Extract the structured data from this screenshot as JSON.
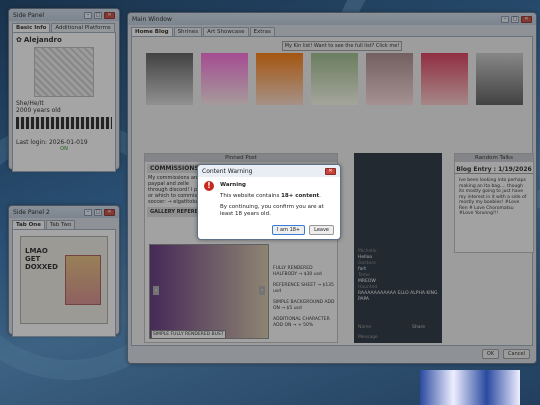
{
  "side_panel1": {
    "title": "Side Panel",
    "tabs": [
      "Basic Info",
      "Additional Platforms"
    ],
    "name": "Alejandro",
    "pronouns": "She/He/It",
    "age": "2000 years old",
    "last_login": "Last login: 2026-01-019",
    "status": "ON"
  },
  "side_panel2": {
    "title": "Side Panel 2",
    "tabs": [
      "Tab One",
      "Tab Two"
    ],
    "image_text": "LMAO GET DOXXED"
  },
  "main": {
    "title": "Main Window",
    "tabs": [
      "Home Blog",
      "Shrines",
      "Art Showcase",
      "Extras"
    ],
    "promo": "My Kin list! Want to see the full list? Click me!",
    "pinned_title": "Pinned Post",
    "commissions_h": "COMMISSIONS",
    "comm_text1": "My commissions are open! I take my commission payment through paypal and zelle",
    "comm_text2": "through discord! I prefer commissions being taken ahead of time",
    "comm_text3": "or which to commission ...",
    "comm_text4": "soccer: → elgatitobarco@...",
    "gallery_h": "GALLERY REFERENCE",
    "caption": "SIMPLE FULLY RENDERED BUST",
    "prices": [
      "FULLY RENDERED HALFBODY → $30 usd",
      "REFERENCE SHEET → $135 usd",
      "SIMPLE BACKGROUND ADD ON → $5 usd",
      "ADDITIONAL CHARACTER ADD ON → + 50%"
    ],
    "chat": [
      {
        "n": "Michelle",
        "m": "Helloo",
        "t": "5 minutes ago"
      },
      {
        "n": "Gesture",
        "m": "fart",
        "t": "5 minutes ago"
      },
      {
        "n": "Tomo",
        "m": "MREOW",
        "t": "5 minutes ago"
      },
      {
        "n": "Haunted",
        "m": "RAAAAAAAAAAA ELLO ALPHA KING PAPA",
        "t": "5 minutes ago"
      }
    ],
    "chat_name_ph": "Name",
    "chat_msg_ph": "Message",
    "chat_send": "Share",
    "random_title": "Random Talks",
    "blog_entry": "Blog Entry : 1/19/2026",
    "blog_text": "Ive been looking into perhaps making an Ita bag.... though its mostly going to just have my interest in it with a side of mostly my boobies! #Love Ren # Love Choromatsu #Love Yorunng!!!",
    "ok": "OK",
    "cancel": "Cancel"
  },
  "dialog": {
    "title": "Content Warning",
    "heading": "Warning",
    "line1_pre": "This website contains ",
    "line1_bold": "18+ content",
    "line1_post": ".",
    "line2": "By continuing, you confirm you are at least 18 years old.",
    "btn_confirm": "I am 18+",
    "btn_leave": "Leave"
  }
}
